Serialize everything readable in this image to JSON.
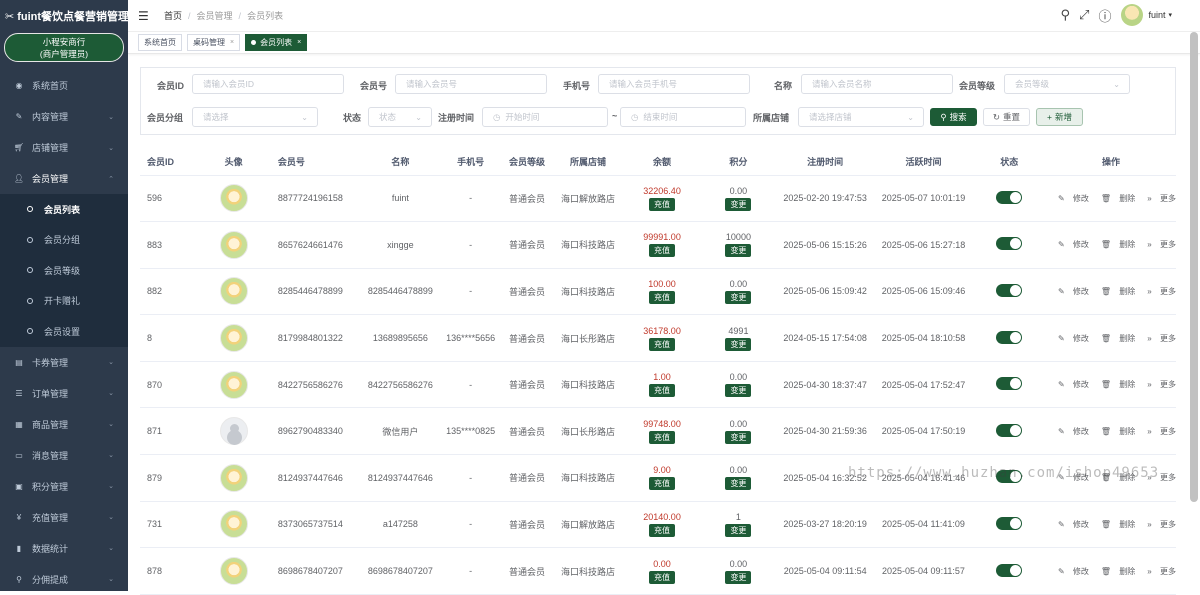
{
  "app": {
    "logo": "fuint餐饮点餐营销管理...",
    "shop_name": "小程安商行",
    "shop_role": "(商户管理员)"
  },
  "sidebar": {
    "items": [
      {
        "label": "系统首页",
        "icon": "dashboard-icon"
      },
      {
        "label": "内容管理",
        "icon": "edit-icon"
      },
      {
        "label": "店铺管理",
        "icon": "cart-icon"
      },
      {
        "label": "会员管理",
        "icon": "user-icon"
      },
      {
        "label": "卡券管理",
        "icon": "card-icon"
      },
      {
        "label": "订单管理",
        "icon": "list-icon"
      },
      {
        "label": "商品管理",
        "icon": "goods-icon"
      },
      {
        "label": "消息管理",
        "icon": "message-icon"
      },
      {
        "label": "积分管理",
        "icon": "points-icon"
      },
      {
        "label": "充值管理",
        "icon": "yen-icon"
      },
      {
        "label": "数据统计",
        "icon": "chart-icon"
      },
      {
        "label": "分佣提成",
        "icon": "share-icon"
      }
    ],
    "sub": [
      "会员列表",
      "会员分组",
      "会员等级",
      "开卡赠礼",
      "会员设置"
    ]
  },
  "breadcrumb": [
    "首页",
    "会员管理",
    "会员列表"
  ],
  "user": {
    "name": "fuint"
  },
  "tabs": [
    "系统首页",
    "桌码管理",
    "会员列表"
  ],
  "filters": {
    "member_id": {
      "label": "会员ID",
      "placeholder": "请输入会员ID"
    },
    "member_no": {
      "label": "会员号",
      "placeholder": "请输入会员号"
    },
    "mobile": {
      "label": "手机号",
      "placeholder": "请输入会员手机号"
    },
    "name": {
      "label": "名称",
      "placeholder": "请输入会员名称"
    },
    "grade": {
      "label": "会员等级",
      "placeholder": "会员等级"
    },
    "group": {
      "label": "会员分组",
      "placeholder": "请选择"
    },
    "status": {
      "label": "状态",
      "placeholder": "状态"
    },
    "reg_time": {
      "label": "注册时间",
      "start": "开始时间",
      "sep": "~",
      "end": "结束时间"
    },
    "store": {
      "label": "所属店铺",
      "placeholder": "请选择店铺"
    },
    "search_btn": "搜索",
    "reset_btn": "重置",
    "add_btn": "新增"
  },
  "table": {
    "headers": [
      "会员ID",
      "头像",
      "会员号",
      "名称",
      "手机号",
      "会员等级",
      "所属店铺",
      "余额",
      "积分",
      "注册时间",
      "活跃时间",
      "状态",
      "操作"
    ],
    "recharge_label": "充值",
    "change_label": "变更",
    "edit_label": "修改",
    "delete_label": "删除",
    "more_label": "更多",
    "rows": [
      {
        "id": "596",
        "avatar": "cartoon",
        "no": "8877724196158",
        "name": "fuint",
        "mobile": "-",
        "grade": "普通会员",
        "store": "海口解放路店",
        "balance": "32206.40",
        "points": "0.00",
        "reg": "2025-02-20 19:47:53",
        "active": "2025-05-07 10:01:19"
      },
      {
        "id": "883",
        "avatar": "cartoon",
        "no": "8657624661476",
        "name": "xingge",
        "mobile": "-",
        "grade": "普通会员",
        "store": "海口科技路店",
        "balance": "99991.00",
        "points": "10000",
        "reg": "2025-05-06 15:15:26",
        "active": "2025-05-06 15:27:18"
      },
      {
        "id": "882",
        "avatar": "cartoon",
        "no": "8285446478899",
        "name": "8285446478899",
        "mobile": "-",
        "grade": "普通会员",
        "store": "海口科技路店",
        "balance": "100.00",
        "points": "0.00",
        "reg": "2025-05-06 15:09:42",
        "active": "2025-05-06 15:09:46"
      },
      {
        "id": "8",
        "avatar": "cartoon",
        "no": "8179984801322",
        "name": "13689895656",
        "mobile": "136****5656",
        "grade": "普通会员",
        "store": "海口长彤路店",
        "balance": "36178.00",
        "points": "4991",
        "reg": "2024-05-15 17:54:08",
        "active": "2025-05-04 18:10:58"
      },
      {
        "id": "870",
        "avatar": "cartoon",
        "no": "8422756586276",
        "name": "8422756586276",
        "mobile": "-",
        "grade": "普通会员",
        "store": "海口科技路店",
        "balance": "1.00",
        "points": "0.00",
        "reg": "2025-04-30 18:37:47",
        "active": "2025-05-04 17:52:47"
      },
      {
        "id": "871",
        "avatar": "default",
        "no": "8962790483340",
        "name": "微信用户",
        "mobile": "135****0825",
        "grade": "普通会员",
        "store": "海口长彤路店",
        "balance": "99748.00",
        "points": "0.00",
        "reg": "2025-04-30 21:59:36",
        "active": "2025-05-04 17:50:19"
      },
      {
        "id": "879",
        "avatar": "cartoon",
        "no": "8124937447646",
        "name": "8124937447646",
        "mobile": "-",
        "grade": "普通会员",
        "store": "海口科技路店",
        "balance": "9.00",
        "points": "0.00",
        "reg": "2025-05-04 16:32:52",
        "active": "2025-05-04 16:41:46"
      },
      {
        "id": "731",
        "avatar": "cartoon",
        "no": "8373065737514",
        "name": "a147258",
        "mobile": "-",
        "grade": "普通会员",
        "store": "海口解放路店",
        "balance": "20140.00",
        "points": "1",
        "reg": "2025-03-27 18:20:19",
        "active": "2025-05-04 11:41:09"
      },
      {
        "id": "878",
        "avatar": "cartoon",
        "no": "8698678407207",
        "name": "8698678407207",
        "mobile": "-",
        "grade": "普通会员",
        "store": "海口科技路店",
        "balance": "0.00",
        "points": "0.00",
        "reg": "2025-05-04 09:11:54",
        "active": "2025-05-04 09:11:57"
      }
    ]
  },
  "watermark": "https://www.huzhan.com/ishop49653",
  "colors": {
    "primary": "#1d5b36",
    "sidebar": "#2d3a4b",
    "balance": "#c0392b"
  }
}
